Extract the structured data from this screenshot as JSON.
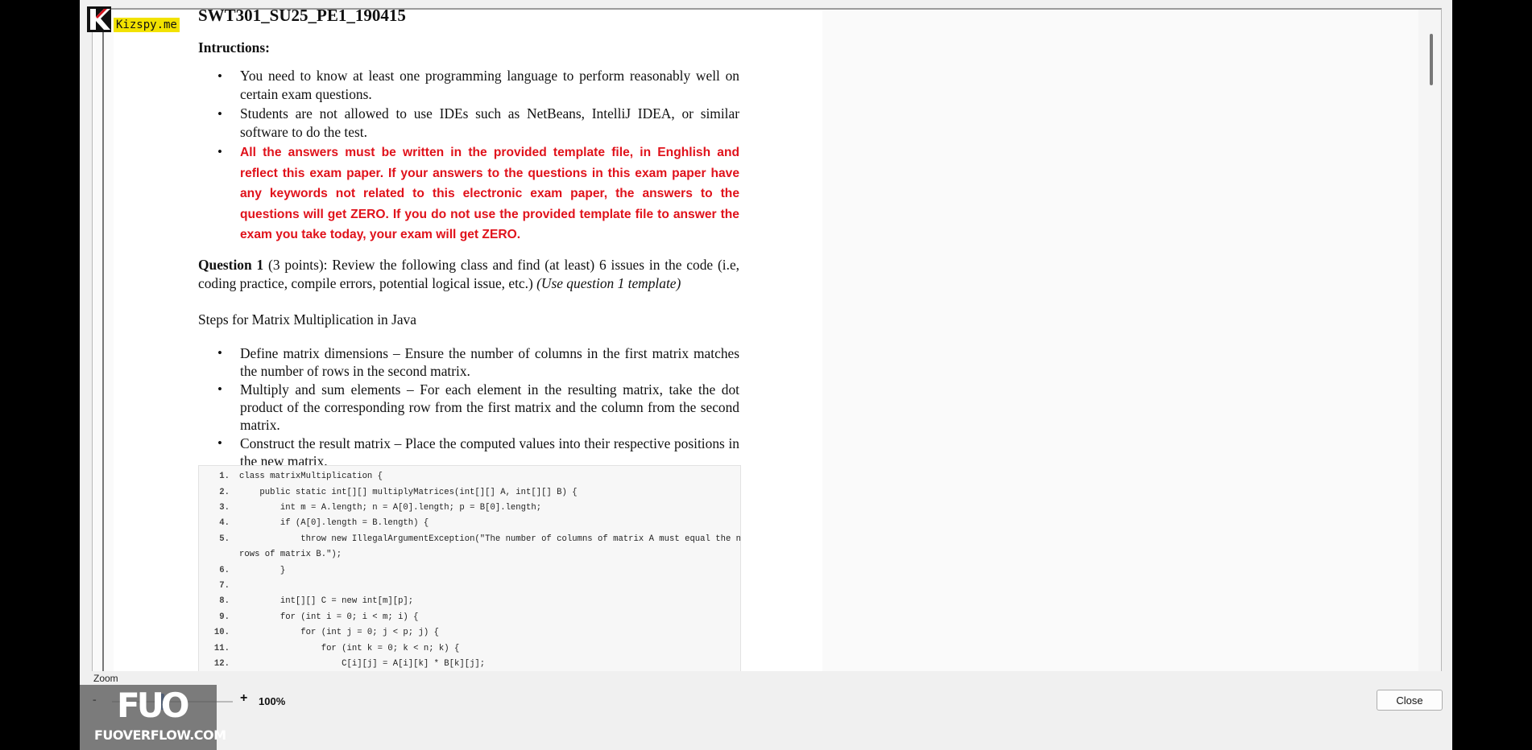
{
  "document": {
    "title": "SWT301_SU25_PE1_190415",
    "instructions_heading": "Intructions:",
    "instructions": [
      "You need to know at least one programming language to perform reasonably well on certain exam questions.",
      "Students are not allowed to use IDEs such as NetBeans, IntelliJ IDEA, or similar software to do the test.",
      "All the answers must be written in the provided template file, in Enghlish and reflect this exam paper. If your answers to the questions in this exam paper have any keywords not related to this electronic exam paper, the answers to the questions will get ZERO. If you do not use the provided template file to answer the exam you take today, your exam will get ZERO."
    ],
    "question1": {
      "label": "Question 1",
      "text": " (3 points): Review the following class and find (at least) 6 issues in the code (i.e, coding practice, compile errors, potential logical issue, etc.) ",
      "note": "(Use question 1 template)"
    },
    "steps_title": "Steps for Matrix Multiplication in Java",
    "steps": [
      "Define matrix dimensions – Ensure the number of columns in the first matrix matches the number of rows in the second matrix.",
      "Multiply and sum elements – For each element in the resulting matrix, take the dot product of the corresponding row from the first matrix and the column from the second matrix.",
      "Construct the result matrix – Place the computed values into their respective positions in the new matrix."
    ],
    "code_lines": [
      {
        "n": "1.",
        "code": "class matrixMultiplication {"
      },
      {
        "n": "2.",
        "code": "    public static int[][] multiplyMatrices(int[][] A, int[][] B) {"
      },
      {
        "n": "3.",
        "code": "        int m = A.length; n = A[0].length; p = B[0].length;"
      },
      {
        "n": "4.",
        "code": "        if (A[0].length = B.length) {"
      },
      {
        "n": "5.",
        "code": "            throw new IllegalArgumentException(\"The number of columns of matrix A must equal the number of"
      },
      {
        "n": "",
        "code": "rows of matrix B.\");"
      },
      {
        "n": "6.",
        "code": "        }"
      },
      {
        "n": "7.",
        "code": ""
      },
      {
        "n": "8.",
        "code": "        int[][] C = new int[m][p];"
      },
      {
        "n": "9.",
        "code": "        for (int i = 0; i < m; i) {"
      },
      {
        "n": "10.",
        "code": "            for (int j = 0; j < p; j) {"
      },
      {
        "n": "11.",
        "code": "                for (int k = 0; k < n; k) {"
      },
      {
        "n": "12.",
        "code": "                    C[i][j] = A[i][k] * B[k][j];"
      }
    ]
  },
  "bullet_char": "•",
  "controls": {
    "zoom_label": "Zoom",
    "zoom_minus": "-",
    "zoom_plus": "+",
    "zoom_value": "100%",
    "zoom_level_fraction": 0.4,
    "close_label": "Close"
  },
  "watermarks": {
    "kizspy_text": "Kizspy.me",
    "fuo_logo": "FUO",
    "fuo_site": "FUOVERFLOW.COM"
  },
  "colors": {
    "warning_red": "#e0121b",
    "slider_blue": "#2f6fd1",
    "logo_yellow": "#f2e200"
  },
  "icons": [
    "kizspy-k-logo-icon",
    "fuo-logo-icon"
  ]
}
